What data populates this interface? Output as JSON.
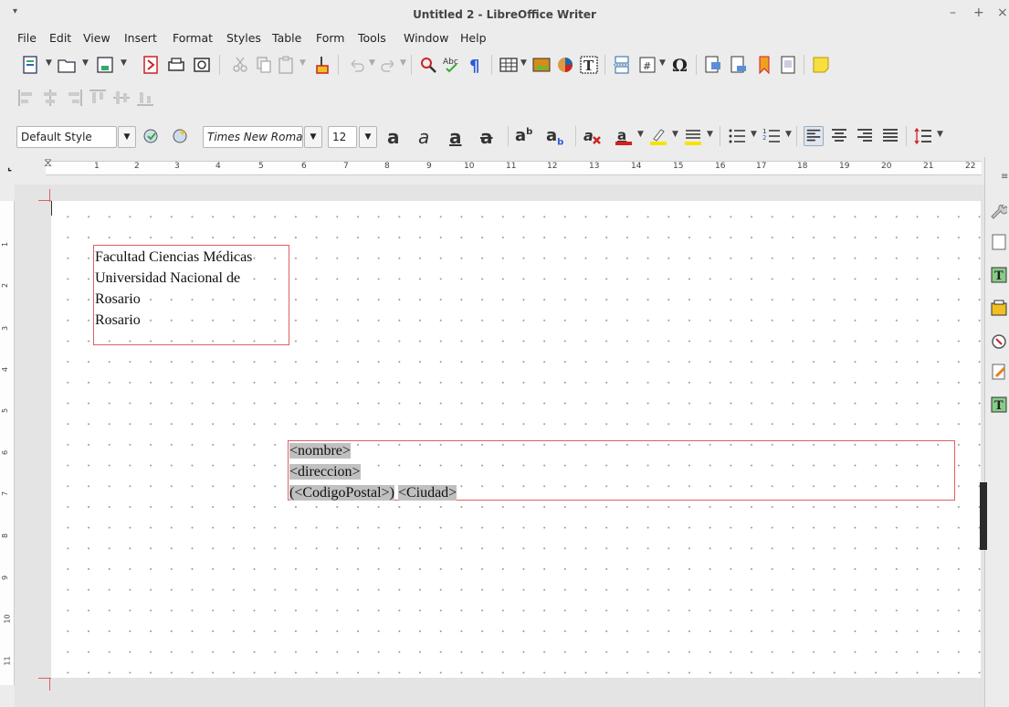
{
  "window": {
    "title": "Untitled 2 - LibreOffice Writer",
    "menu_glyph": "▾",
    "minimize": "–",
    "maximize": "+",
    "close": "×"
  },
  "menu": [
    "File",
    "Edit",
    "View",
    "Insert",
    "Format",
    "Styles",
    "Table",
    "Form",
    "Tools",
    "Window",
    "Help"
  ],
  "formatting": {
    "paragraph_style": "Default Style",
    "font_name": "Times New Roman",
    "font_size": "12"
  },
  "ruler": {
    "horizontal": [
      "1",
      "2",
      "3",
      "4",
      "5",
      "6",
      "7",
      "8",
      "9",
      "10",
      "11",
      "12",
      "13",
      "14",
      "15",
      "16",
      "17",
      "18",
      "19",
      "20",
      "21",
      "22"
    ],
    "vertical": [
      "1",
      "2",
      "3",
      "4",
      "5",
      "6",
      "7",
      "8",
      "9",
      "10",
      "11"
    ]
  },
  "document": {
    "sender": [
      "Facultad Ciencias Médicas",
      "Universidad Nacional de",
      "Rosario",
      "Rosario"
    ],
    "recipient": {
      "nombre": "<nombre>",
      "direccion": "<direccion>",
      "open_paren": "(",
      "codigo_postal": "<CodigoPostal>",
      "close_paren": ")",
      "ciudad": "<Ciudad>"
    }
  },
  "colors": {
    "frame_border": "#e06060",
    "field_shading": "#c0c0c0",
    "font_color_underline": "#d42020",
    "highlight_underline": "#f5e400"
  }
}
